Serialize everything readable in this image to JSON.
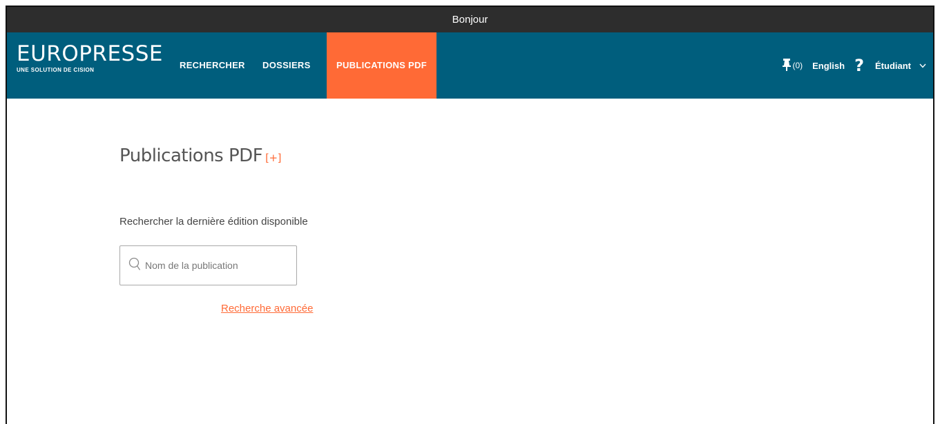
{
  "topbar": {
    "greeting": "Bonjour"
  },
  "brand": {
    "name": "EUROPRESSE",
    "tagline": "UNE SOLUTION DE CISION"
  },
  "nav": {
    "items": [
      {
        "label": "RECHERCHER",
        "active": false
      },
      {
        "label": "DOSSIERS",
        "active": false
      },
      {
        "label": "PUBLICATIONS PDF",
        "active": true
      }
    ],
    "pin_count": "(0)",
    "language": "English",
    "help": "?",
    "user": "Étudiant"
  },
  "main": {
    "title": "Publications PDF",
    "title_expand": "[+]",
    "subtitle": "Rechercher la dernière édition disponible",
    "search": {
      "placeholder": "Nom de la publication",
      "value": ""
    },
    "advanced_link": "Recherche avancée"
  },
  "colors": {
    "topbar": "#2d2d2d",
    "navbar": "#005e7d",
    "accent": "#ff6a36"
  },
  "icons": {
    "pin": "pin-icon",
    "search": "search-icon",
    "chevron": "chevron-down-icon",
    "help": "help-icon"
  }
}
